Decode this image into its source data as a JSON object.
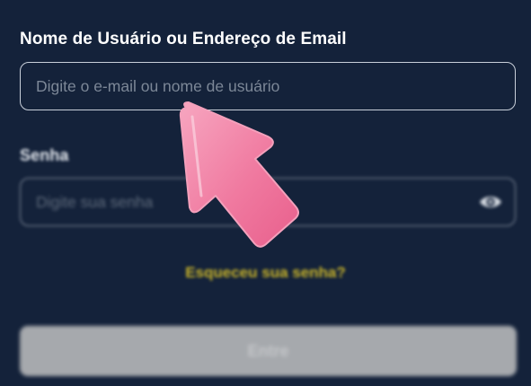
{
  "form": {
    "username_label": "Nome de Usuário ou Endereço de Email",
    "username_placeholder": "Digite o e-mail ou nome de usuário",
    "password_label": "Senha",
    "password_placeholder": "Digite sua senha",
    "forgot_password": "Esqueceu sua senha?",
    "submit_label": "Entre"
  },
  "icons": {
    "password_toggle": "eye-icon",
    "pointer": "pointer-arrow-icon"
  },
  "colors": {
    "background": "#14223a",
    "link": "#c9b42a",
    "button": "#a6a9ad",
    "pointer": "#f07aa0"
  }
}
